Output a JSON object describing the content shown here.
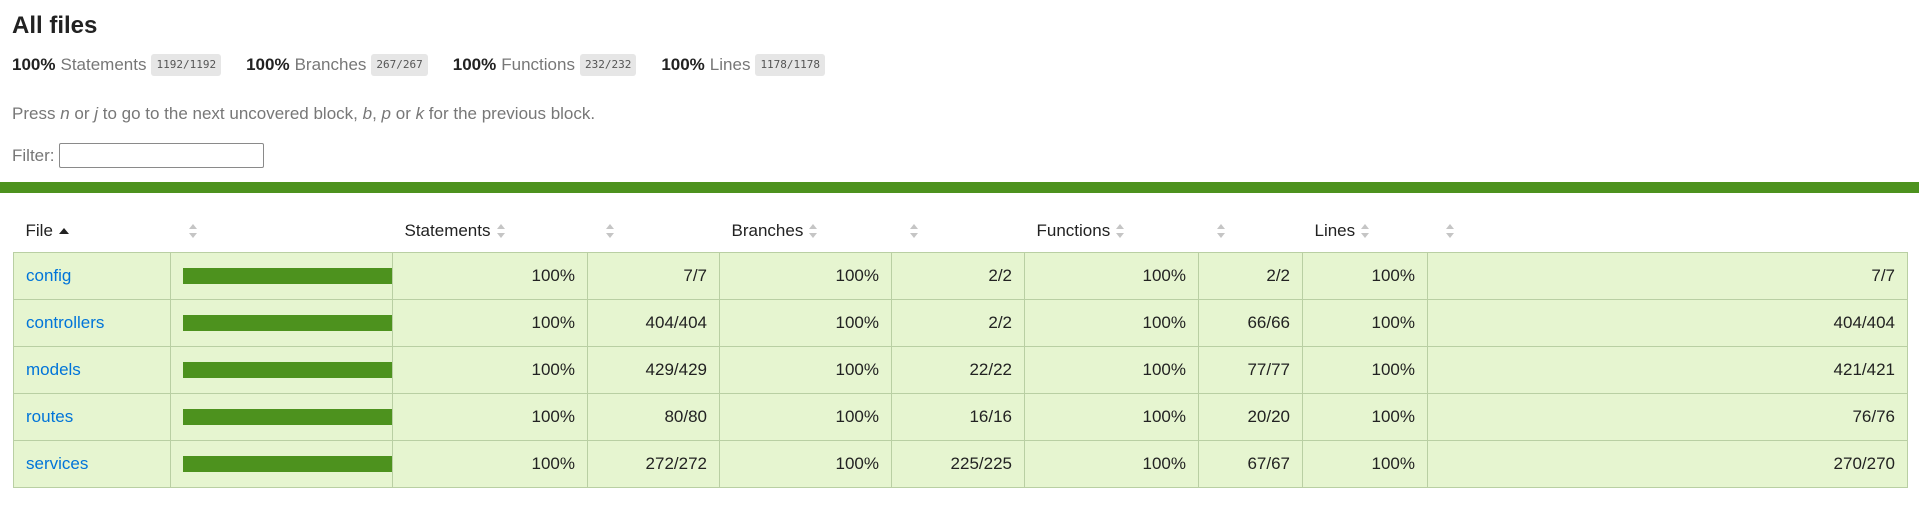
{
  "page": {
    "title": "All files",
    "summary": [
      {
        "pct": "100%",
        "label": "Statements",
        "fraction": "1192/1192"
      },
      {
        "pct": "100%",
        "label": "Branches",
        "fraction": "267/267"
      },
      {
        "pct": "100%",
        "label": "Functions",
        "fraction": "232/232"
      },
      {
        "pct": "100%",
        "label": "Lines",
        "fraction": "1178/1178"
      }
    ],
    "instructions": {
      "press": "Press ",
      "key_n": "n",
      "or1": " or ",
      "key_j": "j",
      "next_text": " to go to the next uncovered block, ",
      "key_b": "b",
      "comma": ", ",
      "key_p": "p",
      "or2": " or ",
      "key_k": "k",
      "prev_text": " for the previous block."
    },
    "filter": {
      "label": "Filter:",
      "value": "",
      "placeholder": ""
    }
  },
  "table": {
    "headers": {
      "file": "File",
      "statements": "Statements",
      "branches": "Branches",
      "functions": "Functions",
      "lines": "Lines"
    },
    "rows": [
      {
        "file": "config",
        "coverage": 1.0,
        "stmt_pct": "100%",
        "stmt_frac": "7/7",
        "br_pct": "100%",
        "br_frac": "2/2",
        "fn_pct": "100%",
        "fn_frac": "2/2",
        "ln_pct": "100%",
        "ln_frac": "7/7"
      },
      {
        "file": "controllers",
        "coverage": 1.0,
        "stmt_pct": "100%",
        "stmt_frac": "404/404",
        "br_pct": "100%",
        "br_frac": "2/2",
        "fn_pct": "100%",
        "fn_frac": "66/66",
        "ln_pct": "100%",
        "ln_frac": "404/404"
      },
      {
        "file": "models",
        "coverage": 1.0,
        "stmt_pct": "100%",
        "stmt_frac": "429/429",
        "br_pct": "100%",
        "br_frac": "22/22",
        "fn_pct": "100%",
        "fn_frac": "77/77",
        "ln_pct": "100%",
        "ln_frac": "421/421"
      },
      {
        "file": "routes",
        "coverage": 1.0,
        "stmt_pct": "100%",
        "stmt_frac": "80/80",
        "br_pct": "100%",
        "br_frac": "16/16",
        "fn_pct": "100%",
        "fn_frac": "20/20",
        "ln_pct": "100%",
        "ln_frac": "76/76"
      },
      {
        "file": "services",
        "coverage": 1.0,
        "stmt_pct": "100%",
        "stmt_frac": "272/272",
        "br_pct": "100%",
        "br_frac": "225/225",
        "fn_pct": "100%",
        "fn_frac": "67/67",
        "ln_pct": "100%",
        "ln_frac": "270/270"
      }
    ]
  },
  "colors": {
    "high_coverage_bar": "#4d921e",
    "high_coverage_row": "#e6f5d0",
    "link": "#0074d9",
    "low_coverage": "#c21f39"
  },
  "icons": {
    "sort_ascending": "sort-ascending-icon",
    "sort_both": "sort-icon"
  }
}
